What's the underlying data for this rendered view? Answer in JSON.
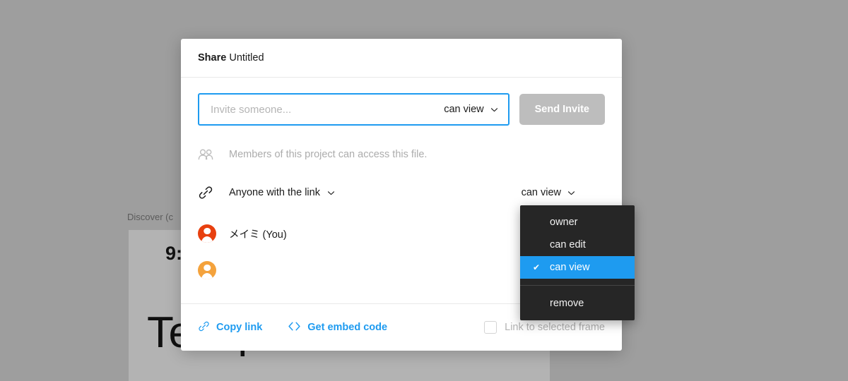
{
  "background": {
    "frame_label": "Discover (c",
    "status_time": "9:",
    "heading": "Test preview"
  },
  "modal": {
    "title_bold": "Share",
    "title_rest": " Untitled",
    "invite": {
      "placeholder": "Invite someone...",
      "value": "",
      "role_label": "can view",
      "send_label": "Send Invite"
    },
    "members_note": "Members of this project can access this file.",
    "link": {
      "scope_label": "Anyone with the link",
      "role_label": "can view"
    },
    "people": [
      {
        "name": "メイミ (You)",
        "avatar_color": "#e8400f"
      },
      {
        "name": "",
        "avatar_color": "#f4a23c"
      }
    ],
    "footer": {
      "copy_link_label": "Copy link",
      "embed_label": "Get embed code",
      "checkbox_label": "Link to selected frame",
      "checkbox_checked": false
    }
  },
  "role_menu": {
    "items": [
      {
        "label": "owner",
        "selected": false
      },
      {
        "label": "can edit",
        "selected": false
      },
      {
        "label": "can view",
        "selected": true
      },
      {
        "label": "remove",
        "selected": false
      }
    ],
    "separator_after_index": 2,
    "check_glyph": "✔"
  },
  "colors": {
    "accent": "#1e9bf0",
    "menu_bg": "#262626",
    "page_bg": "#9e9e9e",
    "disabled_button": "#bdbdbd"
  }
}
